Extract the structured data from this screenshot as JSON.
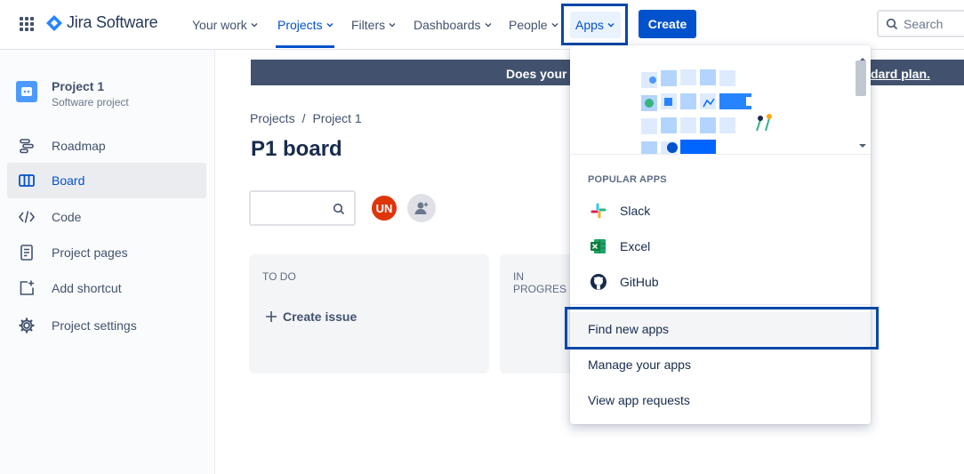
{
  "nav": {
    "logo_text": "Jira Software",
    "items": [
      {
        "label": "Your work"
      },
      {
        "label": "Projects"
      },
      {
        "label": "Filters"
      },
      {
        "label": "Dashboards"
      },
      {
        "label": "People"
      },
      {
        "label": "Apps"
      }
    ],
    "create_label": "Create",
    "search_placeholder": "Search"
  },
  "sidebar": {
    "project_name": "Project 1",
    "project_type": "Software project",
    "items": [
      {
        "label": "Roadmap",
        "icon": "roadmap-icon"
      },
      {
        "label": "Board",
        "icon": "board-icon"
      },
      {
        "label": "Code",
        "icon": "code-icon"
      },
      {
        "label": "Project pages",
        "icon": "page-icon"
      },
      {
        "label": "Add shortcut",
        "icon": "add-shortcut-icon"
      },
      {
        "label": "Project settings",
        "icon": "gear-icon"
      }
    ]
  },
  "banner": {
    "text_left": "Does your t",
    "text_right": "dard plan."
  },
  "breadcrumb": {
    "items": [
      "Projects",
      "Project 1"
    ],
    "separator": "/"
  },
  "board": {
    "title": "P1 board",
    "avatar_initials": "UN",
    "columns": [
      {
        "title": "TO DO",
        "action": "Create issue"
      },
      {
        "title": "IN PROGRES"
      }
    ]
  },
  "apps_menu": {
    "section_title": "POPULAR APPS",
    "popular": [
      {
        "label": "Slack",
        "icon": "slack-icon"
      },
      {
        "label": "Excel",
        "icon": "excel-icon"
      },
      {
        "label": "GitHub",
        "icon": "github-icon"
      }
    ],
    "actions": [
      {
        "label": "Find new apps"
      },
      {
        "label": "Manage your apps"
      },
      {
        "label": "View app requests"
      }
    ]
  },
  "colors": {
    "brand": "#0052cc",
    "highlight_border": "#0747a6",
    "banner_bg": "#42526e",
    "avatar_un": "#de350b"
  }
}
